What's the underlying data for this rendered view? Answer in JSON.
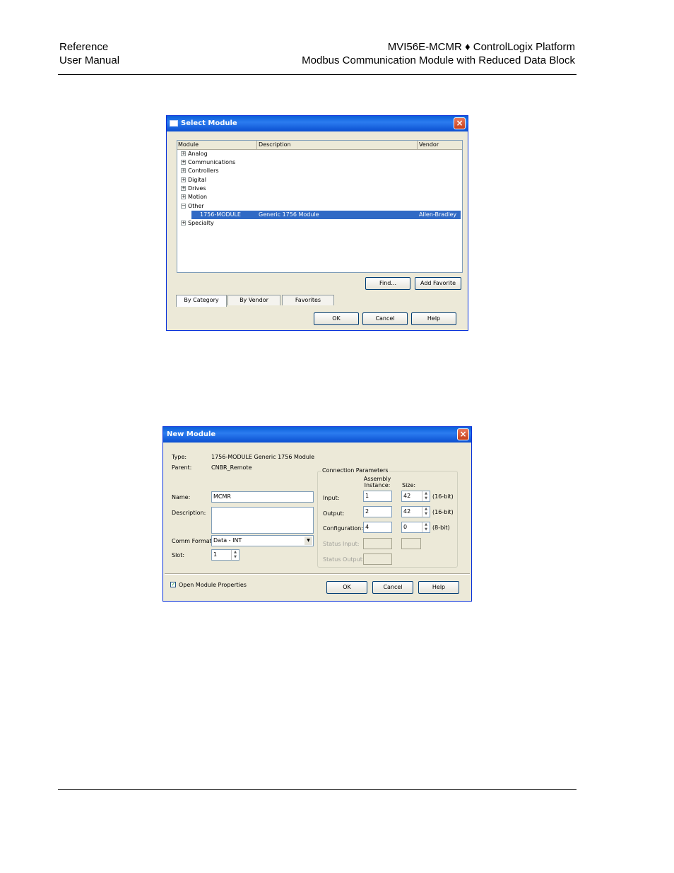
{
  "header": {
    "left_line1": "Reference",
    "left_line2": "User Manual",
    "right_line1": "MVI56E-MCMR ♦ ControlLogix Platform",
    "right_line2": "Modbus Communication Module with Reduced Data Block"
  },
  "select_module": {
    "title": "Select Module",
    "columns": [
      "Module",
      "Description",
      "Vendor"
    ],
    "tree": [
      {
        "label": "Analog",
        "expander": "+"
      },
      {
        "label": "Communications",
        "expander": "+"
      },
      {
        "label": "Controllers",
        "expander": "+"
      },
      {
        "label": "Digital",
        "expander": "+"
      },
      {
        "label": "Drives",
        "expander": "+"
      },
      {
        "label": "Motion",
        "expander": "+"
      },
      {
        "label": "Other",
        "expander": "−"
      },
      {
        "label": "Specialty",
        "expander": "+"
      }
    ],
    "selected_row": {
      "module": "1756-MODULE",
      "description": "Generic 1756 Module",
      "vendor": "Allen-Bradley"
    },
    "find_button": "Find...",
    "add_favorite_button": "Add Favorite",
    "tabs": [
      "By Category",
      "By Vendor",
      "Favorites"
    ],
    "ok_button": "OK",
    "cancel_button": "Cancel",
    "help_button": "Help"
  },
  "new_module": {
    "title": "New Module",
    "type_label": "Type:",
    "type_value": "1756-MODULE Generic 1756 Module",
    "parent_label": "Parent:",
    "parent_value": "CNBR_Remote",
    "name_label": "Name:",
    "name_value": "MCMR",
    "description_label": "Description:",
    "description_value": "",
    "comm_format_label": "Comm Format:",
    "comm_format_value": "Data - INT",
    "slot_label": "Slot:",
    "slot_value": "1",
    "connection_group": "Connection Parameters",
    "assembly_header": "Assembly Instance:",
    "size_header": "Size:",
    "input_label": "Input:",
    "input_instance": "1",
    "input_size": "42",
    "input_unit": "(16-bit)",
    "output_label": "Output:",
    "output_instance": "2",
    "output_size": "42",
    "output_unit": "(16-bit)",
    "config_label": "Configuration:",
    "config_instance": "4",
    "config_size": "0",
    "config_unit": "(8-bit)",
    "status_input_label": "Status Input:",
    "status_output_label": "Status Output:",
    "open_props_label": "Open Module Properties",
    "ok_button": "OK",
    "cancel_button": "Cancel",
    "help_button": "Help"
  }
}
